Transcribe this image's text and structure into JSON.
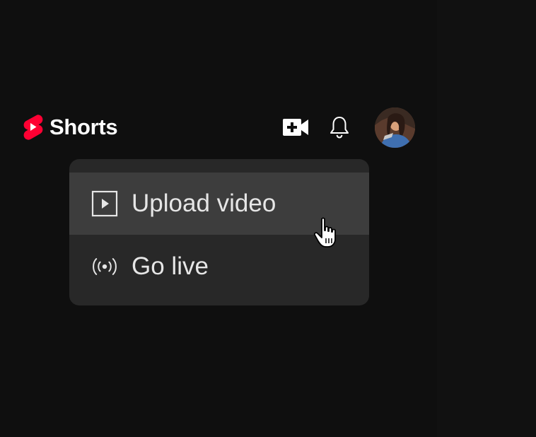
{
  "header": {
    "logo_text": "Shorts",
    "logo_icon": "shorts-logo-icon",
    "create_icon": "video-plus-icon",
    "notifications_icon": "bell-icon",
    "avatar_icon": "user-avatar"
  },
  "create_menu": {
    "items": [
      {
        "label": "Upload video",
        "icon": "play-square-icon",
        "highlighted": true
      },
      {
        "label": "Go live",
        "icon": "broadcast-icon",
        "highlighted": false
      }
    ]
  },
  "colors": {
    "background": "#0f0f0f",
    "menu_background": "#282828",
    "menu_hover": "#3d3d3d",
    "brand_red": "#ff0033",
    "text": "#f1f1f1"
  }
}
